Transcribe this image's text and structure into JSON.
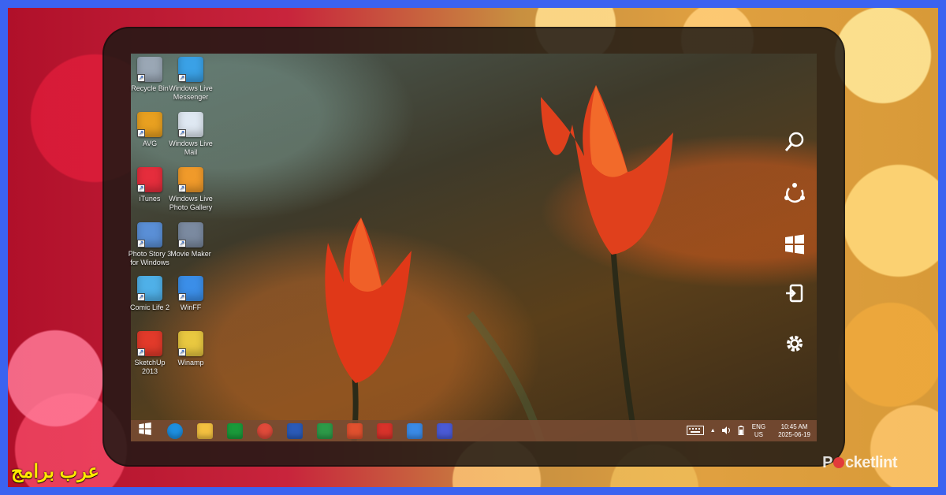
{
  "desktop_icons": [
    {
      "label": "Recycle Bin",
      "icon": "recycle-bin-icon",
      "color": "#9aa7b5"
    },
    {
      "label": "Windows Live Messenger",
      "icon": "messenger-icon",
      "color": "#3aa1e6"
    },
    {
      "label": "AVG",
      "icon": "avg-icon",
      "color": "#e8a020"
    },
    {
      "label": "Windows Live Mail",
      "icon": "mail-icon",
      "color": "#dfe8f2"
    },
    {
      "label": "iTunes",
      "icon": "itunes-icon",
      "color": "#e52d3c"
    },
    {
      "label": "Windows Live Photo Gallery",
      "icon": "photo-gallery-icon",
      "color": "#f09a2a"
    },
    {
      "label": "Photo Story 3 for Windows",
      "icon": "photo-story-icon",
      "color": "#5a8fd6"
    },
    {
      "label": "Movie Maker",
      "icon": "movie-maker-icon",
      "color": "#7b8aa0"
    },
    {
      "label": "Comic Life 2",
      "icon": "comic-life-icon",
      "color": "#4fb0e8"
    },
    {
      "label": "WinFF",
      "icon": "winff-icon",
      "color": "#3b8ee8"
    },
    {
      "label": "SketchUp 2013",
      "icon": "sketchup-icon",
      "color": "#e23a2a"
    },
    {
      "label": "Winamp",
      "icon": "winamp-icon",
      "color": "#e9c840"
    }
  ],
  "charms": [
    "search-icon",
    "share-icon",
    "start-icon",
    "devices-icon",
    "settings-icon"
  ],
  "taskbar_apps": [
    {
      "icon": "windows-start-icon",
      "color": "#ffffff"
    },
    {
      "icon": "internet-explorer-icon",
      "color": "#1e8fe0"
    },
    {
      "icon": "file-explorer-icon",
      "color": "#f3c040"
    },
    {
      "icon": "store-icon",
      "color": "#1a9a3a"
    },
    {
      "icon": "chrome-icon",
      "color": "#e04a3a"
    },
    {
      "icon": "word-icon",
      "color": "#2a5ab8"
    },
    {
      "icon": "app-green-icon",
      "color": "#2d9a48"
    },
    {
      "icon": "voice-recorder-icon",
      "color": "#e0502e"
    },
    {
      "icon": "alarm-icon",
      "color": "#d8322a"
    },
    {
      "icon": "weather-icon",
      "color": "#3a8ae6"
    },
    {
      "icon": "settings-app-icon",
      "color": "#4a5ad6"
    }
  ],
  "tray": {
    "lang_top": "ENG",
    "lang_bottom": "US",
    "time": "10:45 AM",
    "date": "2025-06-19"
  },
  "watermark": {
    "left": "P",
    "right": "cketlint"
  },
  "arabic_label": "عرب برامج"
}
